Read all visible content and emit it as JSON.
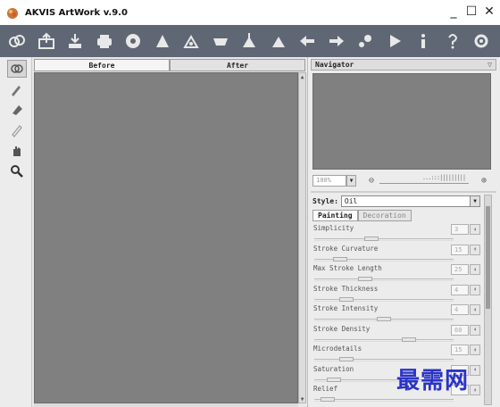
{
  "window": {
    "title": "AKVIS ArtWork v.9.0",
    "minimize": "_",
    "maximize": "☐",
    "close": "✕"
  },
  "toolbar": [
    {
      "name": "links-icon"
    },
    {
      "name": "open-icon"
    },
    {
      "name": "save-icon"
    },
    {
      "name": "print-icon"
    },
    {
      "name": "batch-icon"
    },
    {
      "name": "share-icon"
    },
    {
      "name": "settings-gear-icon"
    },
    {
      "name": "presets-icon"
    },
    {
      "name": "export-icon"
    },
    {
      "name": "import-icon"
    },
    {
      "name": "back-arrow-icon"
    },
    {
      "name": "forward-arrow-icon"
    },
    {
      "name": "preferences-icon"
    },
    {
      "name": "run-icon"
    },
    {
      "name": "info-icon"
    },
    {
      "name": "help-icon"
    },
    {
      "name": "settings-icon"
    }
  ],
  "tabs": {
    "before": "Before",
    "after": "After"
  },
  "navigator": {
    "title": "Navigator",
    "collapse": "▽",
    "zoom": "100%",
    "zoom_minus": "⊖",
    "zoom_plus": "⊕",
    "ticks": "...:::|||||||||"
  },
  "settings": {
    "style_label": "Style:",
    "style_value": "Oil",
    "tab_painting": "Painting",
    "tab_decoration": "Decoration",
    "params": [
      {
        "name": "Simplicity",
        "value": "3",
        "fraction": 0.4
      },
      {
        "name": "Stroke Curvature",
        "value": "15",
        "fraction": 0.15
      },
      {
        "name": "Max Stroke Length",
        "value": "25",
        "fraction": 0.35
      },
      {
        "name": "Stroke Thickness",
        "value": "4",
        "fraction": 0.2
      },
      {
        "name": "Stroke Intensity",
        "value": "4",
        "fraction": 0.5
      },
      {
        "name": "Stroke Density",
        "value": "60",
        "fraction": 0.7
      },
      {
        "name": "Microdetails",
        "value": "15",
        "fraction": 0.2
      },
      {
        "name": "Saturation",
        "value": "",
        "fraction": 0.1
      },
      {
        "name": "Relief",
        "value": "",
        "fraction": 0.05
      }
    ]
  },
  "watermark": "最需网"
}
